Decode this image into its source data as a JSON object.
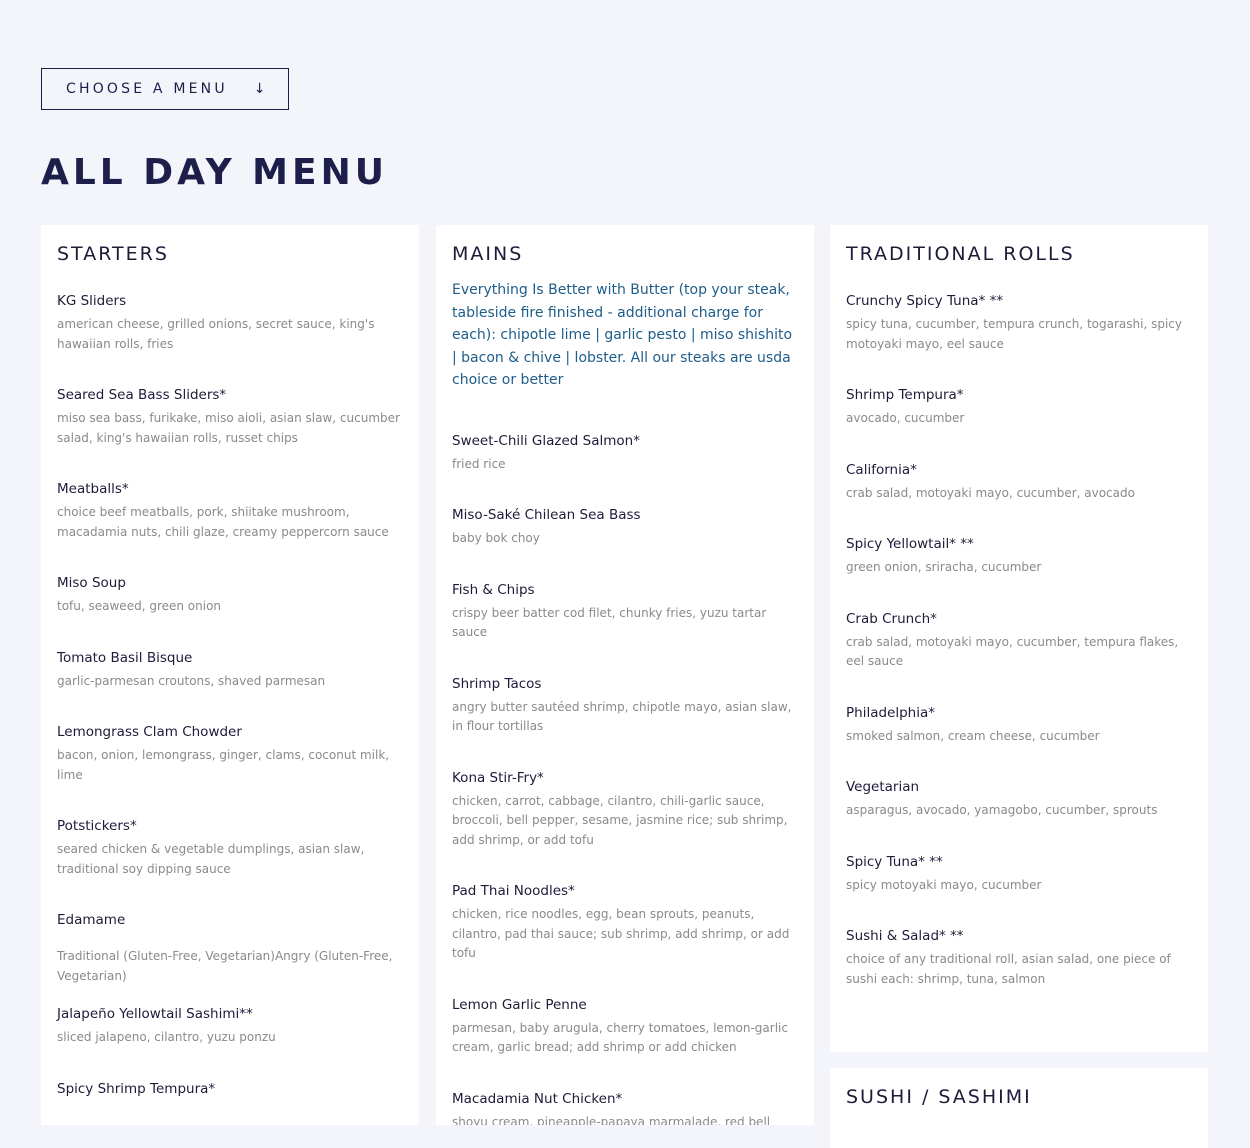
{
  "menu_selector": {
    "label": "CHOOSE A MENU",
    "arrow": "↓",
    "icon": "arrow-down-icon"
  },
  "page_title": "ALL DAY MENU",
  "starters": {
    "title": "STARTERS",
    "items": [
      {
        "name": "KG Sliders",
        "desc": "american cheese, grilled onions, secret sauce, king's hawaiian rolls, fries"
      },
      {
        "name": "Seared Sea Bass Sliders*",
        "desc": "miso sea bass, furikake, miso aioli, asian slaw, cucumber salad, king's hawaiian rolls, russet chips"
      },
      {
        "name": "Meatballs*",
        "desc": "choice beef meatballs, pork, shiitake mushroom, macadamia nuts, chili glaze, creamy peppercorn sauce"
      },
      {
        "name": "Miso Soup",
        "desc": "tofu, seaweed, green onion"
      },
      {
        "name": "Tomato Basil Bisque",
        "desc": "garlic-parmesan croutons, shaved parmesan"
      },
      {
        "name": "Lemongrass Clam Chowder",
        "desc": "bacon, onion, lemongrass, ginger, clams, coconut milk, lime"
      },
      {
        "name": "Potstickers*",
        "desc": "seared chicken & vegetable dumplings, asian slaw, traditional soy dipping sauce"
      },
      {
        "name": "Edamame",
        "desc": "Traditional (Gluten-Free, Vegetarian)Angry (Gluten-Free, Vegetarian)"
      },
      {
        "name": "Jalapeño Yellowtail Sashimi**",
        "desc": "sliced jalapeno, cilantro, yuzu ponzu"
      },
      {
        "name": "Spicy Shrimp Tempura*",
        "desc": ""
      }
    ]
  },
  "mains": {
    "title": "MAINS",
    "intro": "Everything Is Better with Butter (top your steak, tableside fire finished - additional charge for each): chipotle lime | garlic pesto | miso shishito | bacon & chive | lobster. All our steaks are usda choice or better",
    "items": [
      {
        "name": "Sweet-Chili Glazed Salmon*",
        "desc": "fried rice"
      },
      {
        "name": "Miso-Saké Chilean Sea Bass",
        "desc": "baby bok choy"
      },
      {
        "name": "Fish & Chips",
        "desc": "crispy beer batter cod filet, chunky fries, yuzu tartar sauce"
      },
      {
        "name": "Shrimp Tacos",
        "desc": "angry butter sautéed shrimp, chipotle mayo, asian slaw, in flour tortillas"
      },
      {
        "name": "Kona Stir-Fry*",
        "desc": "chicken, carrot, cabbage, cilantro, chili-garlic sauce, broccoli, bell pepper, sesame, jasmine rice; sub shrimp, add shrimp, or add tofu"
      },
      {
        "name": "Pad Thai Noodles*",
        "desc": "chicken, rice noodles, egg, bean sprouts, peanuts, cilantro, pad thai sauce; sub shrimp, add shrimp, or add tofu"
      },
      {
        "name": "Lemon Garlic Penne",
        "desc": "parmesan, baby arugula, cherry tomatoes, lemon-garlic cream, garlic bread; add shrimp or add chicken"
      },
      {
        "name": "Macadamia Nut Chicken*",
        "desc": "shoyu cream, pineapple-papaya marmalade, red bell peppers,"
      }
    ]
  },
  "traditional_rolls": {
    "title": "TRADITIONAL ROLLS",
    "items": [
      {
        "name": "Crunchy Spicy Tuna* **",
        "desc": "spicy tuna, cucumber, tempura crunch, togarashi, spicy motoyaki mayo, eel sauce"
      },
      {
        "name": "Shrimp Tempura*",
        "desc": "avocado, cucumber"
      },
      {
        "name": "California*",
        "desc": "crab salad, motoyaki mayo, cucumber, avocado"
      },
      {
        "name": "Spicy Yellowtail* **",
        "desc": "green onion, sriracha, cucumber"
      },
      {
        "name": "Crab Crunch*",
        "desc": "crab salad, motoyaki mayo, cucumber, tempura flakes, eel sauce"
      },
      {
        "name": "Philadelphia*",
        "desc": "smoked salmon, cream cheese, cucumber"
      },
      {
        "name": "Vegetarian",
        "desc": "asparagus, avocado, yamagobo, cucumber, sprouts"
      },
      {
        "name": "Spicy Tuna* **",
        "desc": "spicy motoyaki mayo, cucumber"
      },
      {
        "name": "Sushi & Salad* **",
        "desc": "choice of any traditional roll, asian salad, one piece of sushi each: shrimp, tuna, salmon"
      }
    ]
  },
  "sushi_sashimi": {
    "title": "SUSHI / SASHIMI"
  }
}
